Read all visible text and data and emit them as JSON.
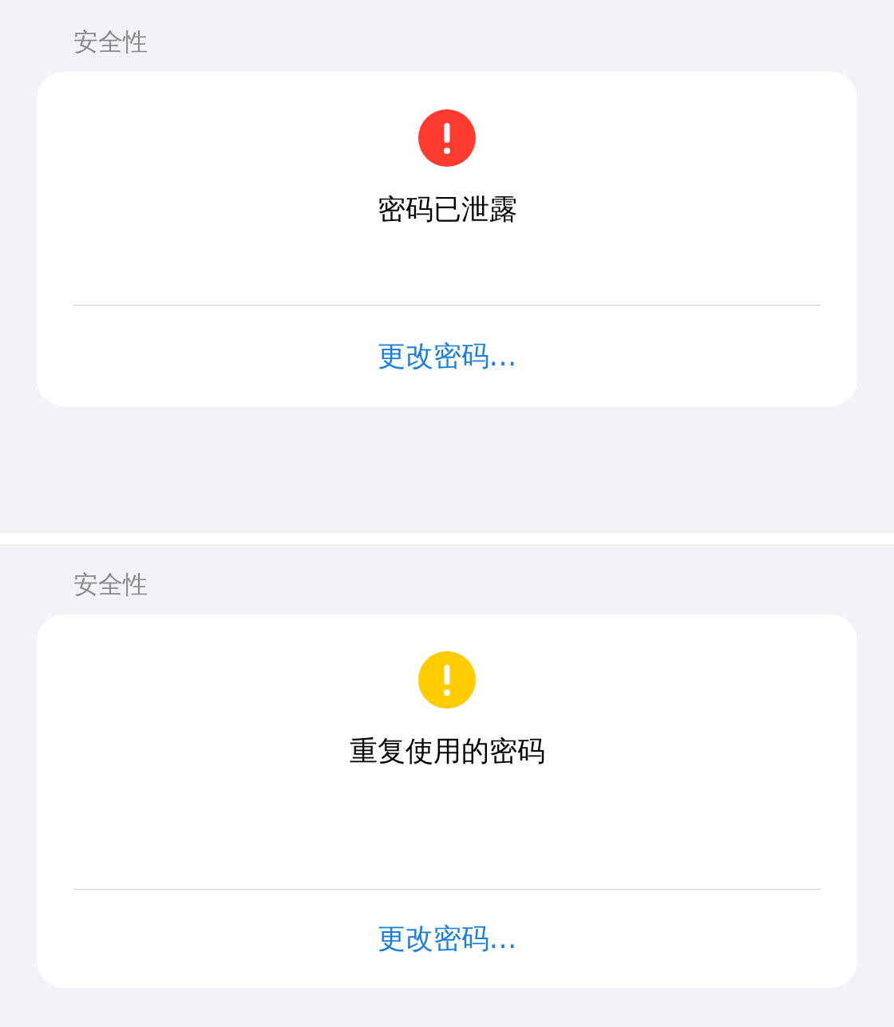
{
  "sections": [
    {
      "header": "安全性",
      "color": "#ff3b30",
      "title": "密码已泄露",
      "action": "更改密码…"
    },
    {
      "header": "安全性",
      "color": "#ffcc00",
      "title": "重复使用的密码",
      "action": "更改密码…"
    }
  ]
}
